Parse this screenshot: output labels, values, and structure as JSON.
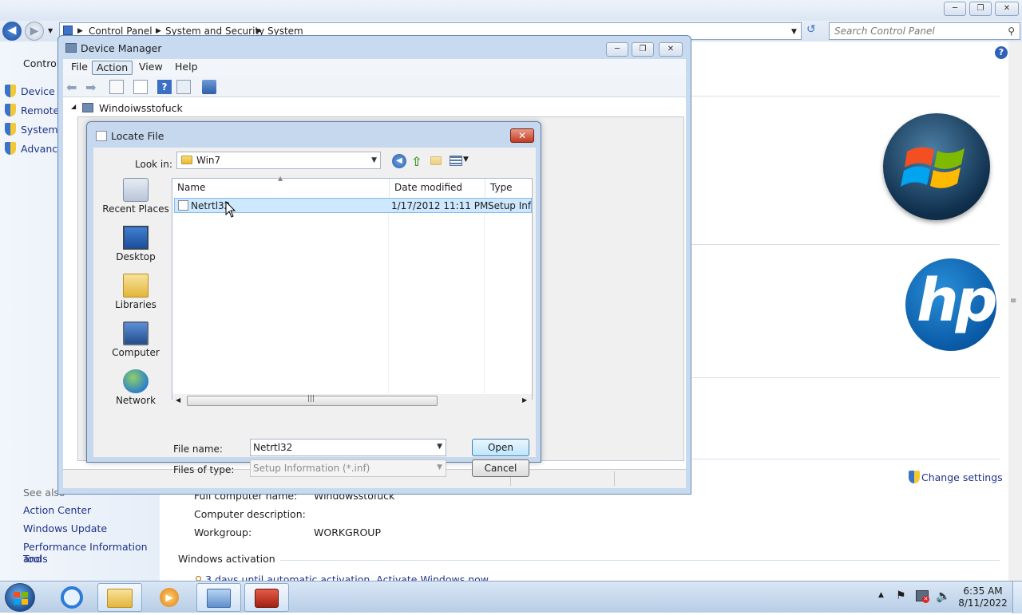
{
  "control_panel": {
    "breadcrumb": [
      "Control Panel",
      "System and Security",
      "System"
    ],
    "search_placeholder": "Search Control Panel",
    "left_header": "Control",
    "tasks": [
      "Device M",
      "Remote",
      "System",
      "Advanc"
    ],
    "see_also": "See also",
    "see_also_links": [
      "Action Center",
      "Windows Update",
      "Performance Information and",
      "Tools"
    ],
    "change_settings": "Change settings",
    "info_rows": [
      {
        "label": "Full computer name:",
        "value": "Windowsstofuck"
      },
      {
        "label": "Computer description:",
        "value": ""
      },
      {
        "label": "Workgroup:",
        "value": "WORKGROUP"
      }
    ],
    "windows_activation": "Windows activation",
    "activation_text": "3 days until automatic activation. Activate Windows now",
    "hp_logo_text": "hp"
  },
  "device_manager": {
    "title": "Device Manager",
    "menu": [
      "File",
      "Action",
      "View",
      "Help"
    ],
    "tree_root": "Windoiwsstofuck"
  },
  "locate_file": {
    "title": "Locate File",
    "look_in_label": "Look in:",
    "look_in_value": "Win7",
    "places": [
      "Recent Places",
      "Desktop",
      "Libraries",
      "Computer",
      "Network"
    ],
    "columns": [
      "Name",
      "Date modified",
      "Type"
    ],
    "files": [
      {
        "name": "Netrtl32",
        "date": "1/17/2012 11:11 PM",
        "type": "Setup Info"
      }
    ],
    "file_name_label": "File name:",
    "file_name_value": "Netrtl32",
    "files_of_type_label": "Files of type:",
    "files_of_type_value": "Setup Information (*.inf)",
    "open_button": "Open",
    "cancel_button": "Cancel"
  },
  "taskbar": {
    "time": "6:35 AM",
    "date": "8/11/2022"
  }
}
